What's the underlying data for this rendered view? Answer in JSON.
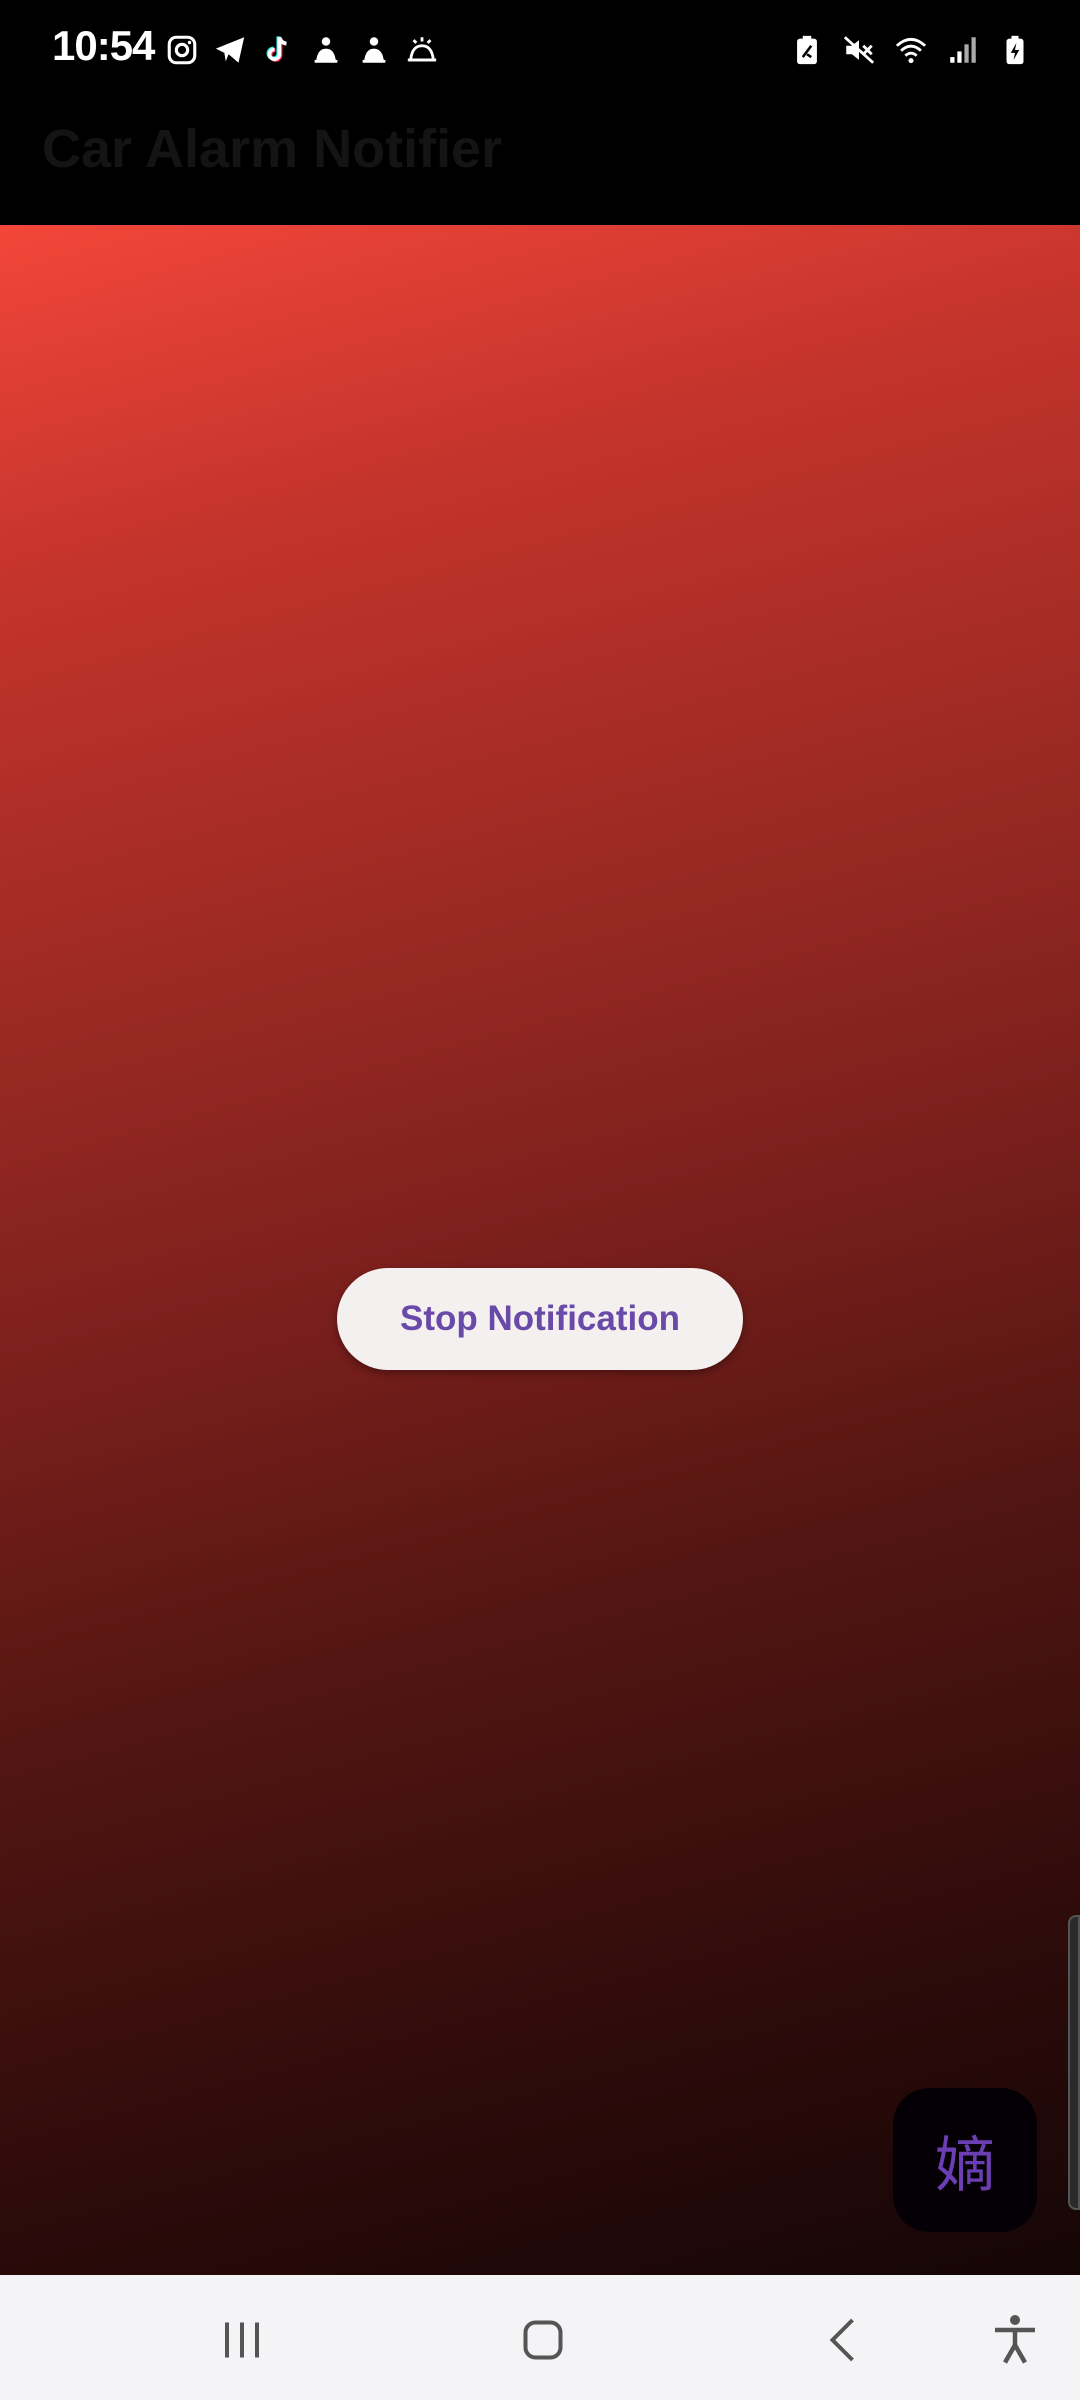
{
  "status_bar": {
    "time": "10:54",
    "left_icons": [
      "instagram-icon",
      "telegram-icon",
      "tiktok-icon",
      "notification-icon",
      "notification-icon",
      "alarm-icon"
    ],
    "right_icons": [
      "battery-saver-icon",
      "mute-icon",
      "wifi-icon",
      "signal-icon",
      "battery-charging-icon"
    ]
  },
  "app_bar": {
    "title": "Car Alarm Notifier"
  },
  "main": {
    "stop_button_label": "Stop Notification",
    "fab_glyph": "嫡",
    "gradient_colors": [
      "#f3463a",
      "#7a1f1c",
      "#150606"
    ]
  },
  "nav_bar": {
    "items": [
      "recent-apps-icon",
      "home-icon",
      "back-icon",
      "accessibility-icon"
    ]
  },
  "colors": {
    "accent": "#6a4aa8",
    "button_bg": "#f3f0ef"
  }
}
